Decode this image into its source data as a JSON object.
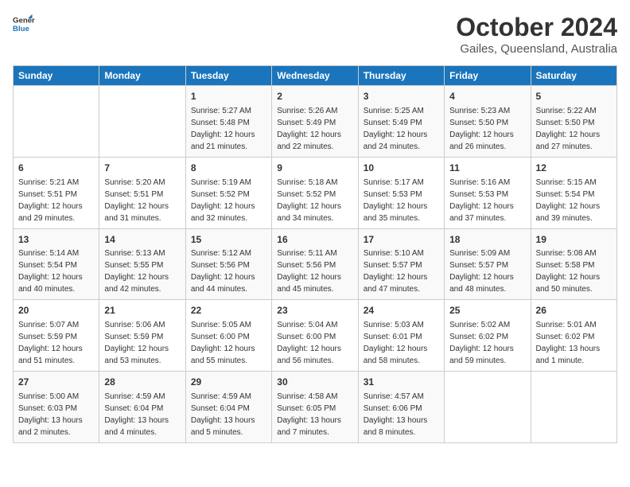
{
  "logo": {
    "line1": "General",
    "line2": "Blue"
  },
  "title": "October 2024",
  "subtitle": "Gailes, Queensland, Australia",
  "days_of_week": [
    "Sunday",
    "Monday",
    "Tuesday",
    "Wednesday",
    "Thursday",
    "Friday",
    "Saturday"
  ],
  "weeks": [
    [
      {
        "day": "",
        "info": ""
      },
      {
        "day": "",
        "info": ""
      },
      {
        "day": "1",
        "info": "Sunrise: 5:27 AM\nSunset: 5:48 PM\nDaylight: 12 hours and 21 minutes."
      },
      {
        "day": "2",
        "info": "Sunrise: 5:26 AM\nSunset: 5:49 PM\nDaylight: 12 hours and 22 minutes."
      },
      {
        "day": "3",
        "info": "Sunrise: 5:25 AM\nSunset: 5:49 PM\nDaylight: 12 hours and 24 minutes."
      },
      {
        "day": "4",
        "info": "Sunrise: 5:23 AM\nSunset: 5:50 PM\nDaylight: 12 hours and 26 minutes."
      },
      {
        "day": "5",
        "info": "Sunrise: 5:22 AM\nSunset: 5:50 PM\nDaylight: 12 hours and 27 minutes."
      }
    ],
    [
      {
        "day": "6",
        "info": "Sunrise: 5:21 AM\nSunset: 5:51 PM\nDaylight: 12 hours and 29 minutes."
      },
      {
        "day": "7",
        "info": "Sunrise: 5:20 AM\nSunset: 5:51 PM\nDaylight: 12 hours and 31 minutes."
      },
      {
        "day": "8",
        "info": "Sunrise: 5:19 AM\nSunset: 5:52 PM\nDaylight: 12 hours and 32 minutes."
      },
      {
        "day": "9",
        "info": "Sunrise: 5:18 AM\nSunset: 5:52 PM\nDaylight: 12 hours and 34 minutes."
      },
      {
        "day": "10",
        "info": "Sunrise: 5:17 AM\nSunset: 5:53 PM\nDaylight: 12 hours and 35 minutes."
      },
      {
        "day": "11",
        "info": "Sunrise: 5:16 AM\nSunset: 5:53 PM\nDaylight: 12 hours and 37 minutes."
      },
      {
        "day": "12",
        "info": "Sunrise: 5:15 AM\nSunset: 5:54 PM\nDaylight: 12 hours and 39 minutes."
      }
    ],
    [
      {
        "day": "13",
        "info": "Sunrise: 5:14 AM\nSunset: 5:54 PM\nDaylight: 12 hours and 40 minutes."
      },
      {
        "day": "14",
        "info": "Sunrise: 5:13 AM\nSunset: 5:55 PM\nDaylight: 12 hours and 42 minutes."
      },
      {
        "day": "15",
        "info": "Sunrise: 5:12 AM\nSunset: 5:56 PM\nDaylight: 12 hours and 44 minutes."
      },
      {
        "day": "16",
        "info": "Sunrise: 5:11 AM\nSunset: 5:56 PM\nDaylight: 12 hours and 45 minutes."
      },
      {
        "day": "17",
        "info": "Sunrise: 5:10 AM\nSunset: 5:57 PM\nDaylight: 12 hours and 47 minutes."
      },
      {
        "day": "18",
        "info": "Sunrise: 5:09 AM\nSunset: 5:57 PM\nDaylight: 12 hours and 48 minutes."
      },
      {
        "day": "19",
        "info": "Sunrise: 5:08 AM\nSunset: 5:58 PM\nDaylight: 12 hours and 50 minutes."
      }
    ],
    [
      {
        "day": "20",
        "info": "Sunrise: 5:07 AM\nSunset: 5:59 PM\nDaylight: 12 hours and 51 minutes."
      },
      {
        "day": "21",
        "info": "Sunrise: 5:06 AM\nSunset: 5:59 PM\nDaylight: 12 hours and 53 minutes."
      },
      {
        "day": "22",
        "info": "Sunrise: 5:05 AM\nSunset: 6:00 PM\nDaylight: 12 hours and 55 minutes."
      },
      {
        "day": "23",
        "info": "Sunrise: 5:04 AM\nSunset: 6:00 PM\nDaylight: 12 hours and 56 minutes."
      },
      {
        "day": "24",
        "info": "Sunrise: 5:03 AM\nSunset: 6:01 PM\nDaylight: 12 hours and 58 minutes."
      },
      {
        "day": "25",
        "info": "Sunrise: 5:02 AM\nSunset: 6:02 PM\nDaylight: 12 hours and 59 minutes."
      },
      {
        "day": "26",
        "info": "Sunrise: 5:01 AM\nSunset: 6:02 PM\nDaylight: 13 hours and 1 minute."
      }
    ],
    [
      {
        "day": "27",
        "info": "Sunrise: 5:00 AM\nSunset: 6:03 PM\nDaylight: 13 hours and 2 minutes."
      },
      {
        "day": "28",
        "info": "Sunrise: 4:59 AM\nSunset: 6:04 PM\nDaylight: 13 hours and 4 minutes."
      },
      {
        "day": "29",
        "info": "Sunrise: 4:59 AM\nSunset: 6:04 PM\nDaylight: 13 hours and 5 minutes."
      },
      {
        "day": "30",
        "info": "Sunrise: 4:58 AM\nSunset: 6:05 PM\nDaylight: 13 hours and 7 minutes."
      },
      {
        "day": "31",
        "info": "Sunrise: 4:57 AM\nSunset: 6:06 PM\nDaylight: 13 hours and 8 minutes."
      },
      {
        "day": "",
        "info": ""
      },
      {
        "day": "",
        "info": ""
      }
    ]
  ]
}
